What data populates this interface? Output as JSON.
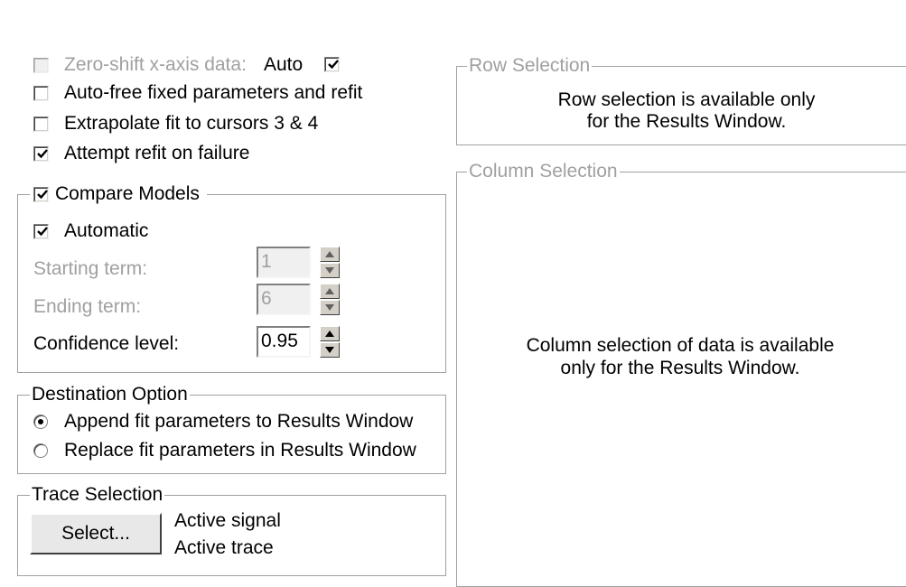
{
  "options": {
    "zero_shift_pre": "Zero-shift x-axis data:",
    "auto_label": "Auto",
    "auto_checked": true,
    "auto_free": "Auto-free fixed parameters and refit",
    "extrapolate": "Extrapolate fit to cursors 3 & 4",
    "attempt_refit": "Attempt refit on failure",
    "attempt_refit_checked": true
  },
  "compare_models": {
    "title": "Compare Models",
    "checked": true,
    "automatic_label": "Automatic",
    "automatic_checked": true,
    "starting_term_label": "Starting term:",
    "starting_term_value": "1",
    "ending_term_label": "Ending term:",
    "ending_term_value": "6",
    "confidence_label": "Confidence level:",
    "confidence_value": "0.95"
  },
  "destination": {
    "title": "Destination Option",
    "append_label": "Append fit parameters to Results Window",
    "replace_label": "Replace fit parameters in Results Window",
    "selected": "append"
  },
  "trace_selection": {
    "title": "Trace Selection",
    "select_button": "Select...",
    "active_signal": "Active signal",
    "active_trace": "Active trace"
  },
  "row_selection": {
    "title": "Row Selection",
    "line1": "Row selection is available only",
    "line2": "for the Results Window."
  },
  "column_selection": {
    "title": "Column Selection",
    "line1": "Column selection of data is available",
    "line2": "only for the Results Window."
  },
  "colors": {
    "disabled_text": "#a0a0a0",
    "group_border": "#a0a0a0"
  }
}
